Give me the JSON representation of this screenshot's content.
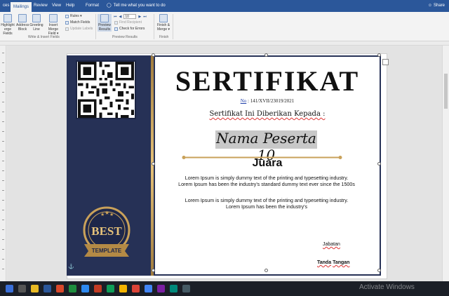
{
  "tabs": [
    "ces",
    "Mailings",
    "Review",
    "View",
    "Help",
    "Format"
  ],
  "tell_me": "Tell me what you want to do",
  "share": "Share",
  "ribbon": {
    "highlight": [
      "Highlight",
      "erge Fields"
    ],
    "address": [
      "Address",
      "Block"
    ],
    "greeting": [
      "Greeting",
      "Line"
    ],
    "insert_merge": [
      "Insert Merge",
      "Field ▾"
    ],
    "rules": "Rules ▾",
    "match_fields": "Match Fields",
    "update_labels": "Update Labels",
    "group_write": "Write & Insert Fields",
    "preview": [
      "Preview",
      "Results"
    ],
    "record_number": "10",
    "find_recipient": "Find Recipient",
    "check_errors": "Check for Errors",
    "group_preview": "Preview Results",
    "finish": [
      "Finish &",
      "Merge ▾"
    ],
    "group_finish": "Finish"
  },
  "certificate": {
    "title": "SERTIFIKAT",
    "nomor_label": "No",
    "nomor_value": " : 141/XVII/23019/2021",
    "given_to": "Sertifikat Ini Diberikan Kepada :",
    "name": "Nama Peserta 10",
    "rank": "Juara",
    "lorem1": "Lorem Ipsum is simply dummy text of the printing and typesetting industry. Lorem Ipsum has been the industry's standard dummy text ever since the 1500s",
    "lorem2": "Lorem Ipsum is simply dummy text of the printing and typesetting industry. Lorem Ipsum has been the industry's",
    "position": "Jabatan",
    "signature_a": "Tanda",
    "signature_b": "Tangan",
    "badge_top": "BEST",
    "badge_ribbon": "TEMPLATE"
  },
  "watermark": "Activate Windows",
  "colors": {
    "word_blue": "#2b579a",
    "panel_navy": "#263156",
    "gold": "#c9a15a"
  }
}
